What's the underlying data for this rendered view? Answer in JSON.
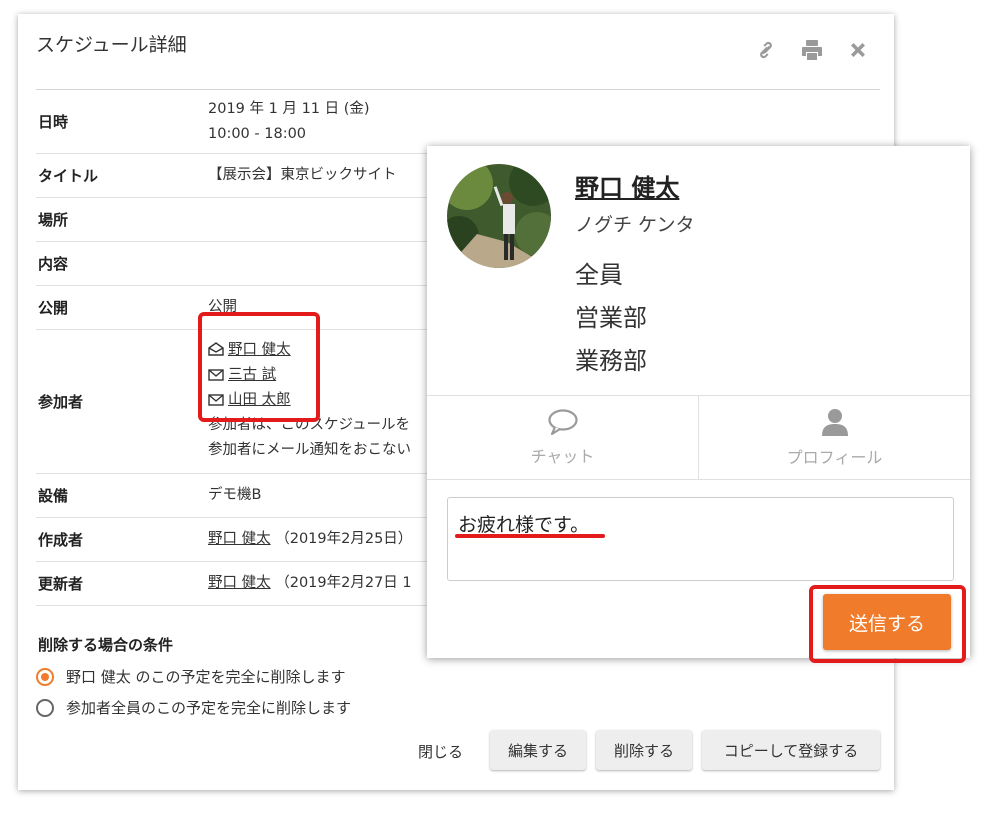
{
  "dialog": {
    "title": "スケジュール詳細",
    "icons": [
      "link-icon",
      "print-icon",
      "close-icon"
    ],
    "rows": {
      "date": {
        "label": "日時",
        "line1": "2019 年 1 月 11 日 (金)",
        "line2": "10:00 - 18:00"
      },
      "title": {
        "label": "タイトル",
        "value": "【展示会】東京ビックサイト"
      },
      "place": {
        "label": "場所",
        "value": ""
      },
      "content": {
        "label": "内容",
        "value": ""
      },
      "public": {
        "label": "公開",
        "value": "公開"
      },
      "participants": {
        "label": "参加者",
        "people": [
          "野口 健太",
          "三古 試",
          "山田 太郎"
        ],
        "note1": "参加者は、このスケジュールを",
        "note2": "参加者にメール通知をおこない"
      },
      "equipment": {
        "label": "設備",
        "value": "デモ機B"
      },
      "creator": {
        "label": "作成者",
        "name": "野口 健太",
        "date": "（2019年2月25日）"
      },
      "updater": {
        "label": "更新者",
        "name": "野口 健太",
        "date": "（2019年2月27日 1"
      }
    },
    "delete_condition": {
      "title": "削除する場合の条件",
      "option1": "野口 健太 のこの予定を完全に削除します",
      "option2": "参加者全員のこの予定を完全に削除します",
      "selected": 1
    },
    "buttons": {
      "close": "閉じる",
      "edit": "編集する",
      "delete": "削除する",
      "copy": "コピーして登録する"
    }
  },
  "popup": {
    "name": "野口 健太",
    "kana": "ノグチ ケンタ",
    "groups": [
      "全員",
      "営業部",
      "業務部"
    ],
    "tabs": {
      "chat": "チャット",
      "profile": "プロフィール"
    },
    "message": "お疲れ様です。",
    "send": "送信する"
  },
  "colors": {
    "accent": "#f07b2a",
    "highlight": "#e41b1b"
  }
}
